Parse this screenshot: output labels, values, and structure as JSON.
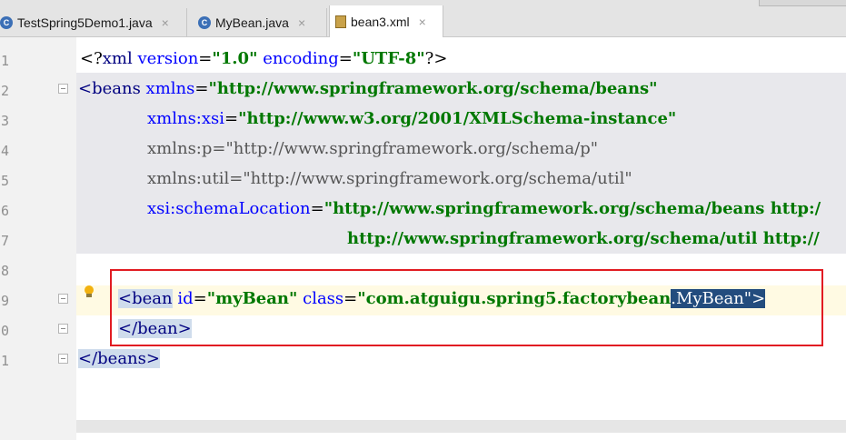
{
  "tabs": [
    {
      "label": "TestSpring5Demo1.java",
      "icon": "java-class-icon",
      "active": false
    },
    {
      "label": "MyBean.java",
      "icon": "java-class-icon",
      "active": false
    },
    {
      "label": "bean3.xml",
      "icon": "xml-file-icon",
      "active": true
    }
  ],
  "close_glyph": "×",
  "line_numbers": [
    "1",
    "2",
    "3",
    "4",
    "5",
    "6",
    "7",
    "8",
    "9",
    "0",
    "1"
  ],
  "code": {
    "l1": {
      "a": "<?",
      "b": "xml",
      "c": " version",
      "d": "=",
      "e": "\"1.0\"",
      "f": " encoding",
      "g": "=",
      "h": "\"UTF-8\"",
      "i": "?>"
    },
    "l2": {
      "a": "<beans",
      "b": " xmlns",
      "c": "=",
      "d": "\"http://www.springframework.org/schema/beans\""
    },
    "l3": {
      "a": "xmlns:xsi",
      "b": "=",
      "c": "\"http://www.w3.org/2001/XMLSchema-instance\""
    },
    "l4": {
      "a": "xmlns:p",
      "b": "=",
      "c": "\"http://www.springframework.org/schema/p\""
    },
    "l5": {
      "a": "xmlns:util",
      "b": "=",
      "c": "\"http://www.springframework.org/schema/util\""
    },
    "l6": {
      "a": "xsi:schemaLocation",
      "b": "=",
      "c": "\"http://www.springframework.org/schema/beans http:/"
    },
    "l7": {
      "a": "http://www.springframework.org/schema/util http://"
    },
    "l9": {
      "a": "<bean",
      "b": " id",
      "c": "=",
      "d": "\"myBean\"",
      "e": " class",
      "f": "=",
      "g": "\"com.atguigu.spring5.factorybean",
      "h": ".MyBean\"",
      "i": ">"
    },
    "l10": {
      "a": "</bean>"
    },
    "l11": {
      "a": "</beans>"
    }
  },
  "colors": {
    "annotation_box": "#e11b22",
    "selection": "#234c7e"
  }
}
